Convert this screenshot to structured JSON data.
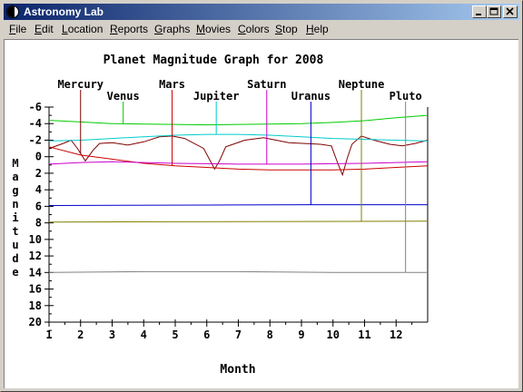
{
  "window": {
    "title": "Astronomy Lab",
    "min_glyph": "_",
    "max_glyph": "□",
    "close_glyph": "X"
  },
  "menu": [
    "File",
    "Edit",
    "Location",
    "Reports",
    "Graphs",
    "Movies",
    "Colors",
    "Stop",
    "Help"
  ],
  "chart_data": {
    "type": "line",
    "title": "Planet Magnitude Graph for 2008",
    "xlabel": "Month",
    "ylabel": "Magnitude",
    "x_ticks": [
      "1",
      "2",
      "3",
      "4",
      "5",
      "6",
      "7",
      "8",
      "9",
      "10",
      "11",
      "12"
    ],
    "y_ticks": [
      "-6",
      "-4",
      "-2",
      "0",
      "2",
      "4",
      "6",
      "8",
      "10",
      "12",
      "14",
      "16",
      "18",
      "20"
    ],
    "xlim": [
      1,
      13
    ],
    "ylim": [
      -6,
      20
    ],
    "y_inverted": true,
    "series": [
      {
        "name": "Mercury",
        "color": "#800000",
        "label_x": 2.0,
        "points": [
          [
            1,
            -1.0
          ],
          [
            1.45,
            -1.6
          ],
          [
            1.7,
            -2.0
          ],
          [
            1.9,
            -1.0
          ],
          [
            2.15,
            0.5
          ],
          [
            2.4,
            -0.8
          ],
          [
            2.6,
            -1.6
          ],
          [
            3.0,
            -1.7
          ],
          [
            3.5,
            -1.4
          ],
          [
            4.0,
            -1.8
          ],
          [
            4.5,
            -2.4
          ],
          [
            4.9,
            -2.5
          ],
          [
            5.3,
            -2.2
          ],
          [
            5.9,
            -1.0
          ],
          [
            6.25,
            1.5
          ],
          [
            6.4,
            0.5
          ],
          [
            6.6,
            -1.2
          ],
          [
            7.2,
            -2.0
          ],
          [
            7.8,
            -2.3
          ],
          [
            8.2,
            -2.0
          ],
          [
            8.6,
            -1.7
          ],
          [
            9.1,
            -1.6
          ],
          [
            9.6,
            -1.5
          ],
          [
            9.95,
            -1.3
          ],
          [
            10.15,
            0.8
          ],
          [
            10.3,
            2.2
          ],
          [
            10.45,
            0.2
          ],
          [
            10.6,
            -1.5
          ],
          [
            10.9,
            -2.5
          ],
          [
            11.3,
            -2.0
          ],
          [
            11.8,
            -1.5
          ],
          [
            12.2,
            -1.3
          ],
          [
            12.6,
            -1.6
          ],
          [
            13,
            -2.0
          ]
        ]
      },
      {
        "name": "Venus",
        "color": "#00cc00",
        "label_x": 3.35,
        "points": [
          [
            1,
            -4.4
          ],
          [
            2,
            -4.2
          ],
          [
            3,
            -4.0
          ],
          [
            4,
            -3.95
          ],
          [
            5,
            -3.9
          ],
          [
            6,
            -3.85
          ],
          [
            7,
            -3.9
          ],
          [
            8,
            -3.95
          ],
          [
            9,
            -4.0
          ],
          [
            10,
            -4.15
          ],
          [
            11,
            -4.35
          ],
          [
            12,
            -4.7
          ],
          [
            13,
            -5.0
          ]
        ]
      },
      {
        "name": "Mars",
        "color": "#cc0000",
        "label_x": 4.9,
        "points": [
          [
            1,
            -1.2
          ],
          [
            2,
            -0.2
          ],
          [
            3,
            0.3
          ],
          [
            4,
            0.8
          ],
          [
            5,
            1.1
          ],
          [
            6,
            1.3
          ],
          [
            7,
            1.5
          ],
          [
            8,
            1.6
          ],
          [
            9,
            1.6
          ],
          [
            10,
            1.6
          ],
          [
            11,
            1.5
          ],
          [
            12,
            1.3
          ],
          [
            13,
            1.1
          ]
        ]
      },
      {
        "name": "Jupiter",
        "color": "#00cccc",
        "label_x": 6.3,
        "points": [
          [
            1,
            -1.9
          ],
          [
            2,
            -2.0
          ],
          [
            3,
            -2.2
          ],
          [
            4,
            -2.4
          ],
          [
            5,
            -2.6
          ],
          [
            6,
            -2.7
          ],
          [
            7,
            -2.7
          ],
          [
            8,
            -2.6
          ],
          [
            9,
            -2.4
          ],
          [
            10,
            -2.2
          ],
          [
            11,
            -2.1
          ],
          [
            12,
            -2.0
          ],
          [
            13,
            -1.9
          ]
        ]
      },
      {
        "name": "Saturn",
        "color": "#cc00cc",
        "label_x": 7.9,
        "points": [
          [
            1,
            0.9
          ],
          [
            2,
            0.7
          ],
          [
            3,
            0.6
          ],
          [
            4,
            0.7
          ],
          [
            5,
            0.8
          ],
          [
            6,
            0.85
          ],
          [
            7,
            0.9
          ],
          [
            8,
            0.9
          ],
          [
            9,
            0.9
          ],
          [
            10,
            0.85
          ],
          [
            11,
            0.8
          ],
          [
            12,
            0.7
          ],
          [
            13,
            0.6
          ]
        ]
      },
      {
        "name": "Uranus",
        "color": "#0000cc",
        "label_x": 9.3,
        "points": [
          [
            1,
            5.9
          ],
          [
            6,
            5.85
          ],
          [
            9.3,
            5.8
          ],
          [
            13,
            5.8
          ]
        ]
      },
      {
        "name": "Neptune",
        "color": "#808000",
        "label_x": 10.9,
        "points": [
          [
            1,
            7.9
          ],
          [
            13,
            7.8
          ]
        ]
      },
      {
        "name": "Pluto",
        "color": "#808080",
        "label_x": 12.3,
        "points": [
          [
            1,
            14.0
          ],
          [
            4,
            13.9
          ],
          [
            7,
            13.9
          ],
          [
            10,
            14.0
          ],
          [
            13,
            14.0
          ]
        ]
      }
    ]
  }
}
